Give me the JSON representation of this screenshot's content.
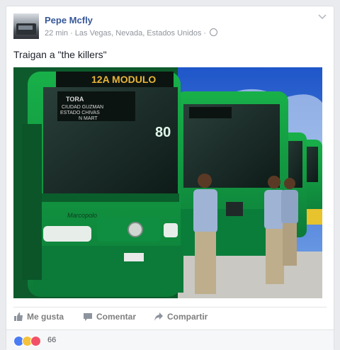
{
  "post": {
    "author": "Pepe Mcfly",
    "meta": "22 min · Las Vegas, Nevada, Estados Unidos ·",
    "text": "Traigan a \"the killers\""
  },
  "photo": {
    "sign_main": "12A MODULO",
    "sign_dest": "TORA\nCIUDAD GUZMAN\nESTADO CHIVAS\nN MART",
    "brand": "Marcopolo",
    "number": "80"
  },
  "actions": {
    "like": "Me gusta",
    "comment": "Comentar",
    "share": "Compartir"
  },
  "reactions": {
    "count": "66",
    "icons": [
      "like-icon",
      "haha-icon",
      "love-icon"
    ],
    "colors": {
      "like": "#4a7cf3",
      "haha": "#f7c23b",
      "love": "#f25268"
    }
  }
}
